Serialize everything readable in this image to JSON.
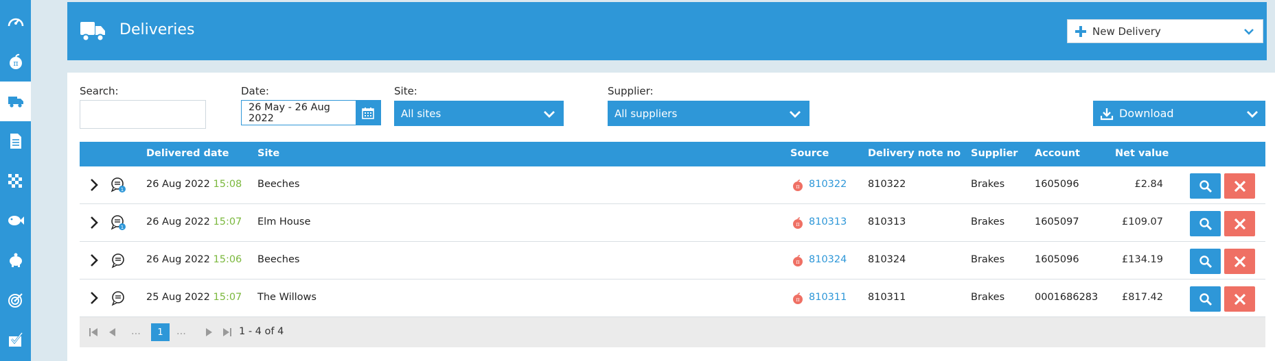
{
  "nav": {
    "items": [
      {
        "icon": "dashboard-gauge-icon"
      },
      {
        "icon": "pi-apple-icon"
      },
      {
        "icon": "delivery-truck-icon",
        "active": true
      },
      {
        "icon": "document-icon"
      },
      {
        "icon": "checkered-flag-icon"
      },
      {
        "icon": "fish-icon"
      },
      {
        "icon": "piggy-bank-icon"
      },
      {
        "icon": "target-icon"
      },
      {
        "icon": "checklist-icon"
      }
    ]
  },
  "header": {
    "title": "Deliveries",
    "new_delivery_label": "New Delivery"
  },
  "filters": {
    "search_label": "Search:",
    "search_value": "",
    "date_label": "Date:",
    "date_value": "26 May - 26 Aug 2022",
    "site_label": "Site:",
    "site_value": "All sites",
    "supplier_label": "Supplier:",
    "supplier_value": "All suppliers",
    "download_label": "Download"
  },
  "table": {
    "columns": [
      "Delivered date",
      "Site",
      "Source",
      "Delivery note no",
      "Supplier",
      "Account",
      "Net value"
    ],
    "rows": [
      {
        "date": "26 Aug 2022",
        "time": "15:08",
        "site": "Beeches",
        "source": "810322",
        "delivery_note_no": "810322",
        "supplier": "Brakes",
        "account": "1605096",
        "net_value": "£2.84",
        "note_badge": "1"
      },
      {
        "date": "26 Aug 2022",
        "time": "15:07",
        "site": "Elm House",
        "source": "810313",
        "delivery_note_no": "810313",
        "supplier": "Brakes",
        "account": "1605097",
        "net_value": "£109.07",
        "note_badge": "1"
      },
      {
        "date": "26 Aug 2022",
        "time": "15:06",
        "site": "Beeches",
        "source": "810324",
        "delivery_note_no": "810324",
        "supplier": "Brakes",
        "account": "1605096",
        "net_value": "£134.19",
        "note_badge": ""
      },
      {
        "date": "25 Aug 2022",
        "time": "15:07",
        "site": "The Willows",
        "source": "810311",
        "delivery_note_no": "810311",
        "supplier": "Brakes",
        "account": "0001686283",
        "net_value": "£817.42",
        "note_badge": ""
      }
    ]
  },
  "pager": {
    "current_page": "1",
    "dots": "...",
    "info": "1 - 4 of 4"
  },
  "colors": {
    "primary": "#2e97d8",
    "danger": "#ef7064",
    "time_green": "#7bb83d",
    "background": "#dbe8ef"
  }
}
